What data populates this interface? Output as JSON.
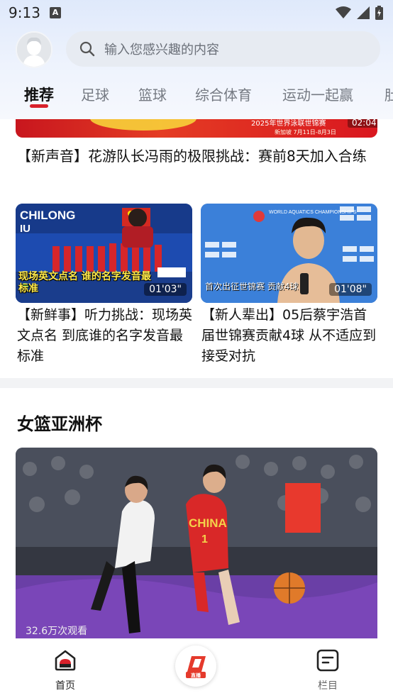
{
  "status_bar": {
    "time": "9:13",
    "notification_icon": "A"
  },
  "header": {
    "search_placeholder": "输入您感兴趣的内容"
  },
  "tabs": [
    {
      "label": "推荐",
      "active": true
    },
    {
      "label": "足球"
    },
    {
      "label": "篮球"
    },
    {
      "label": "综合体育"
    },
    {
      "label": "运动一起赢"
    },
    {
      "label": "肚"
    }
  ],
  "feed": {
    "banner": {
      "text": "2025年世界泳联世锦赛",
      "sub": "新加坡 7月11日-8月3日",
      "duration": "02:04"
    },
    "main_title": "【新声音】花游队长冯雨的极限挑战：赛前8天加入合练",
    "cards": [
      {
        "thumb_top": "CHILONG",
        "thumb_caption": "现场英文点名 谁的名字发音最标准",
        "duration": "01'03\"",
        "title": "【新鲜事】听力挑战：现场英文点名 到底谁的名字发音最标准"
      },
      {
        "thumb_top": "WORLD AQUATICS CHAMPIONSHIPS",
        "thumb_caption": "首次出征世锦赛 贡献4球",
        "duration": "01'08\"",
        "title": "【新人辈出】05后蔡宇浩首届世锦赛贡献4球 从不适应到接受对抗"
      }
    ],
    "section_title": "女篮亚洲杯",
    "big_photo": {
      "jersey_text": "CHINA",
      "jersey_number": "1",
      "views": "32.6万次观看"
    }
  },
  "bottom_nav": {
    "home": "首页",
    "live": "直播",
    "column": "栏目"
  },
  "colors": {
    "accent_red": "#d8212b",
    "tab_inactive": "#757a82"
  }
}
